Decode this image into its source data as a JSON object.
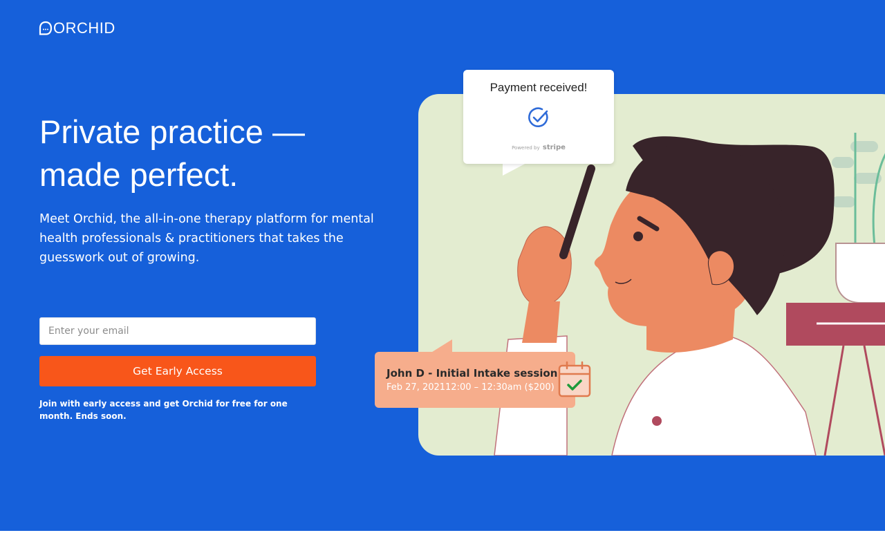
{
  "brand": {
    "logo_text": "ORCHID",
    "accent": "#1660da",
    "cta_color": "#f8561a"
  },
  "hero": {
    "headline_line1": "Private practice —",
    "headline_line2": "made perfect.",
    "subtext_line1": "Meet Orchid, the all-in-one therapy platform for mental",
    "subtext_line2": "health professionals & practitioners that takes the",
    "subtext_line3": "guesswork out of growing."
  },
  "signup": {
    "email_placeholder": "Enter your email",
    "email_value": "",
    "button_label": "Get Early Access",
    "note": "Join with early access and get Orchid for free for one month. Ends soon."
  },
  "payment_card": {
    "title": "Payment received!",
    "powered_by": "Powered by",
    "provider": "stripe",
    "icon": "check-circle-icon"
  },
  "session_card": {
    "title": "John D - Initial Intake session",
    "time": "Feb 27, 202112:00 – 12:30am ($200)",
    "icon": "calendar-check-icon"
  }
}
